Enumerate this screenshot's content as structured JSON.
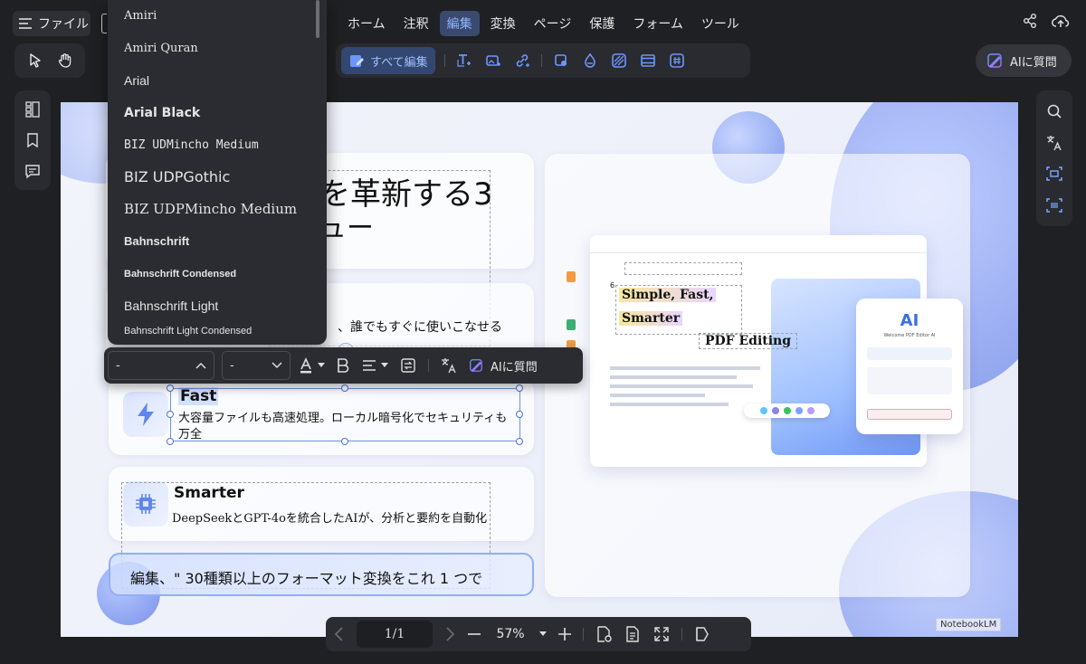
{
  "topbar": {
    "file_label": "ファイル",
    "menu": [
      {
        "label": "ホーム"
      },
      {
        "label": "注釈"
      },
      {
        "label": "編集"
      },
      {
        "label": "変換"
      },
      {
        "label": "ページ"
      },
      {
        "label": "保護"
      },
      {
        "label": "フォーム"
      },
      {
        "label": "ツール"
      }
    ],
    "active_menu": "編集"
  },
  "edit_toolbar": {
    "edit_all_label": "すべて編集"
  },
  "ai_button_label": "AIに質問",
  "font_dropdown": {
    "items": [
      "Amiri",
      "Amiri Quran",
      "Arial",
      "Arial Black",
      "BIZ UDMincho Medium",
      "BIZ UDPGothic",
      "BIZ UDPMincho Medium",
      "Bahnschrift",
      "Bahnschrift Condensed",
      "Bahnschrift Light",
      "Bahnschrift Light Condensed"
    ]
  },
  "format_toolbar": {
    "font_value": "-",
    "size_value": "-",
    "ai_label": "AIに質問"
  },
  "document": {
    "heading_line1": "を革新する3",
    "heading_line2": "ュー",
    "intro_text": "、誰でもすぐに使いこなせる",
    "fast_title": "Fast",
    "fast_body": "大容量ファイルも高速処理。ローカル暗号化でセキュリティも万全",
    "smarter_title": "Smarter",
    "smarter_body": "DeepSeekとGPT-4oを統合したAIが、分析と要約を自動化",
    "banner_text": "編集、\" 30種類以上のフォーマット変換をこれ 1 つで",
    "preview_simple_fast": "Simple, Fast,",
    "preview_smarter": "Smarter",
    "preview_pdf_editing": "PDF Editing",
    "preview_ai_title": "AI",
    "preview_ai_sub": "Welcome PDF Editor AI",
    "preview_page_number": "6",
    "watermark": "NotebookLM"
  },
  "zoom_bar": {
    "page_indicator": "1/1",
    "zoom_level": "57%"
  },
  "colors": {
    "accent": "#4b74d6",
    "active_tab_bg": "#3a4a6e",
    "panel_bg": "#2a2b30"
  }
}
